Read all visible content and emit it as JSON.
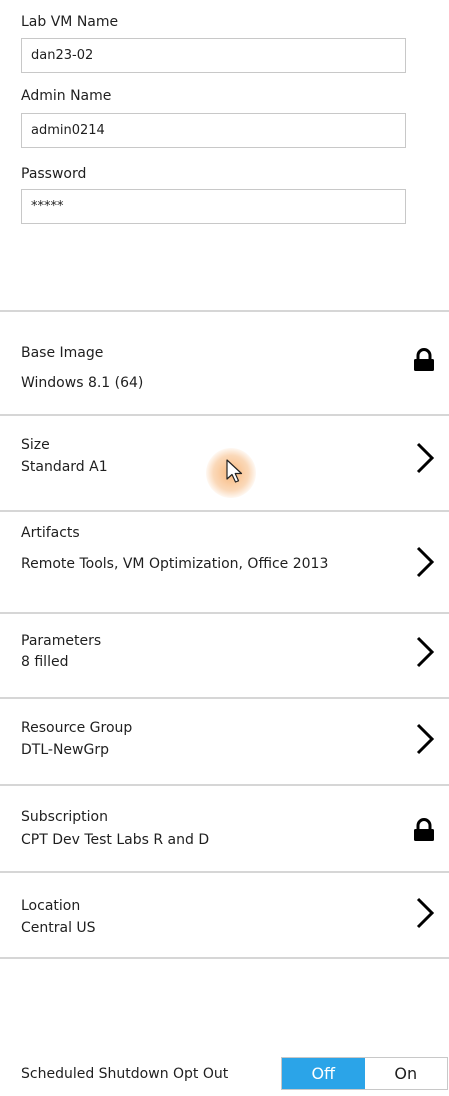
{
  "form": {
    "lab_vm_name": {
      "label": "Lab VM Name",
      "value": "dan23-02"
    },
    "admin_name": {
      "label": "Admin Name",
      "value": "admin0214"
    },
    "password": {
      "label": "Password",
      "value": "*****"
    }
  },
  "settings": {
    "base_image": {
      "label": "Base Image",
      "value": "Windows 8.1 (64)",
      "icon": "lock-icon"
    },
    "size": {
      "label": "Size",
      "value": "Standard A1",
      "icon": "chevron-right-icon"
    },
    "artifacts": {
      "label": "Artifacts",
      "value": "Remote Tools, VM Optimization, Office 2013",
      "icon": "chevron-right-icon"
    },
    "parameters": {
      "label": "Parameters",
      "value": "8 filled",
      "icon": "chevron-right-icon"
    },
    "resource_group": {
      "label": "Resource Group",
      "value": "DTL-NewGrp",
      "icon": "chevron-right-icon"
    },
    "subscription": {
      "label": "Subscription",
      "value": "CPT Dev Test Labs R and D",
      "icon": "lock-icon"
    },
    "location": {
      "label": "Location",
      "value": "Central US",
      "icon": "chevron-right-icon"
    }
  },
  "shutdown": {
    "label": "Scheduled Shutdown Opt Out",
    "off_label": "Off",
    "on_label": "On",
    "selected": "Off"
  },
  "colors": {
    "accent": "#2ba4e8",
    "divider": "#d6d6d6",
    "border": "#c8c8c8",
    "text": "#1f1f1f"
  }
}
